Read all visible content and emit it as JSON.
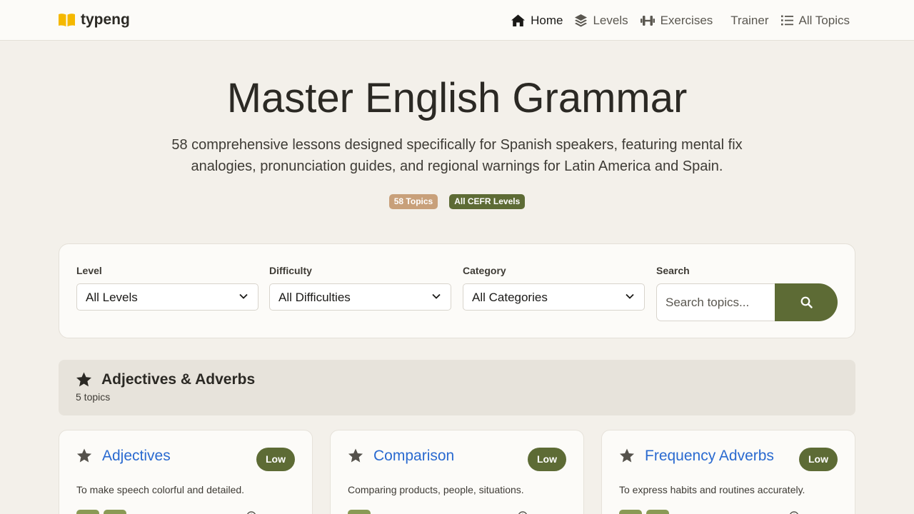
{
  "brand": {
    "name": "typeng",
    "logo_color": "#f5b800"
  },
  "nav": {
    "items": [
      {
        "label": "Home",
        "icon": "home-icon"
      },
      {
        "label": "Levels",
        "icon": "layers-icon"
      },
      {
        "label": "Exercises",
        "icon": "dumbbell-icon"
      },
      {
        "label": "Trainer",
        "icon": ""
      },
      {
        "label": "All Topics",
        "icon": "list-icon"
      }
    ]
  },
  "hero": {
    "title": "Master English Grammar",
    "subtitle": "58 comprehensive lessons designed specifically for Spanish speakers, featuring mental fix analogies, pronunciation guides, and regional warnings for Latin America and Spain.",
    "badges": [
      "58 Topics",
      "All CEFR Levels"
    ]
  },
  "filters": {
    "level": {
      "label": "Level",
      "value": "All Levels"
    },
    "difficulty": {
      "label": "Difficulty",
      "value": "All Difficulties"
    },
    "category": {
      "label": "Category",
      "value": "All Categories"
    },
    "search": {
      "label": "Search",
      "placeholder": "Search topics..."
    }
  },
  "category": {
    "title": "Adjectives & Adverbs",
    "count": "5 topics",
    "icon": "star-icon"
  },
  "cards": [
    {
      "title": "Adjectives",
      "difficulty": "Low",
      "description": "To make speech colorful and detailed."
    },
    {
      "title": "Comparison",
      "difficulty": "Low",
      "description": "Comparing products, people, situations."
    },
    {
      "title": "Frequency Adverbs",
      "difficulty": "Low",
      "description": "To express habits and routines accurately."
    }
  ],
  "colors": {
    "accent": "#5d6b35",
    "link": "#2a6ad0",
    "badge_topics": "#c8a07a",
    "background": "#f3f0ea"
  }
}
